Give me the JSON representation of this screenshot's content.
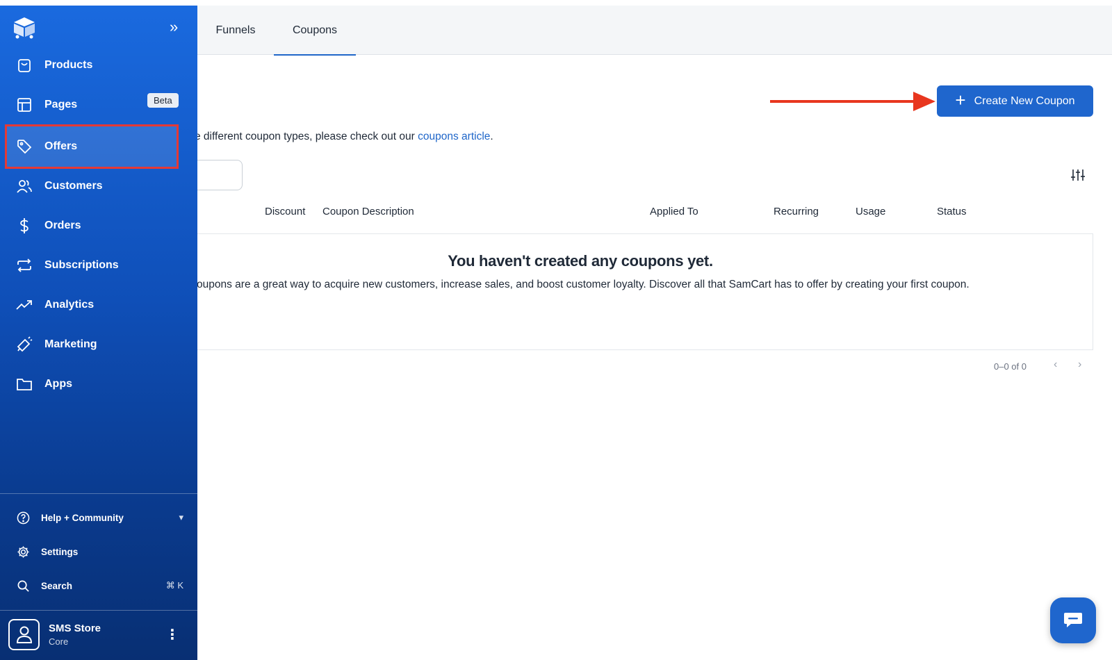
{
  "tabs": [
    {
      "label": "Funnels"
    },
    {
      "label": "Coupons"
    }
  ],
  "toolbar": {
    "create_label": "Create New Coupon"
  },
  "info": {
    "text_before": "e different coupon types, please check out our ",
    "link_text": "coupons article",
    "text_after": "."
  },
  "table": {
    "headers": [
      "Discount",
      "Coupon Description",
      "Applied To",
      "Recurring",
      "Usage",
      "Status"
    ]
  },
  "empty_state": {
    "title": "You haven't created any coupons yet.",
    "description": "oupons are a great way to acquire new customers, increase sales, and boost customer loyalty. Discover all that SamCart has to offer by creating your first coupon."
  },
  "pagination": {
    "range": "0–0 of 0",
    "prev": "‹",
    "next": "›"
  },
  "sidebar": {
    "collapse_glyph": "»",
    "items": [
      {
        "label": "Products",
        "icon": "bag-icon"
      },
      {
        "label": "Pages",
        "icon": "layout-icon",
        "badge": "Beta"
      },
      {
        "label": "Offers",
        "icon": "tag-icon"
      },
      {
        "label": "Customers",
        "icon": "users-icon"
      },
      {
        "label": "Orders",
        "icon": "dollar-icon"
      },
      {
        "label": "Subscriptions",
        "icon": "repeat-icon"
      },
      {
        "label": "Analytics",
        "icon": "trend-icon"
      },
      {
        "label": "Marketing",
        "icon": "megaphone-icon"
      },
      {
        "label": "Apps",
        "icon": "folder-icon"
      }
    ],
    "bottom": {
      "help": "Help + Community",
      "settings": "Settings",
      "search": "Search",
      "search_shortcut": "⌘ K"
    },
    "store": {
      "name": "SMS Store",
      "plan": "Core"
    }
  },
  "colors": {
    "primary": "#1f66cd",
    "highlight": "#e53935",
    "arrow": "#e8361e"
  }
}
